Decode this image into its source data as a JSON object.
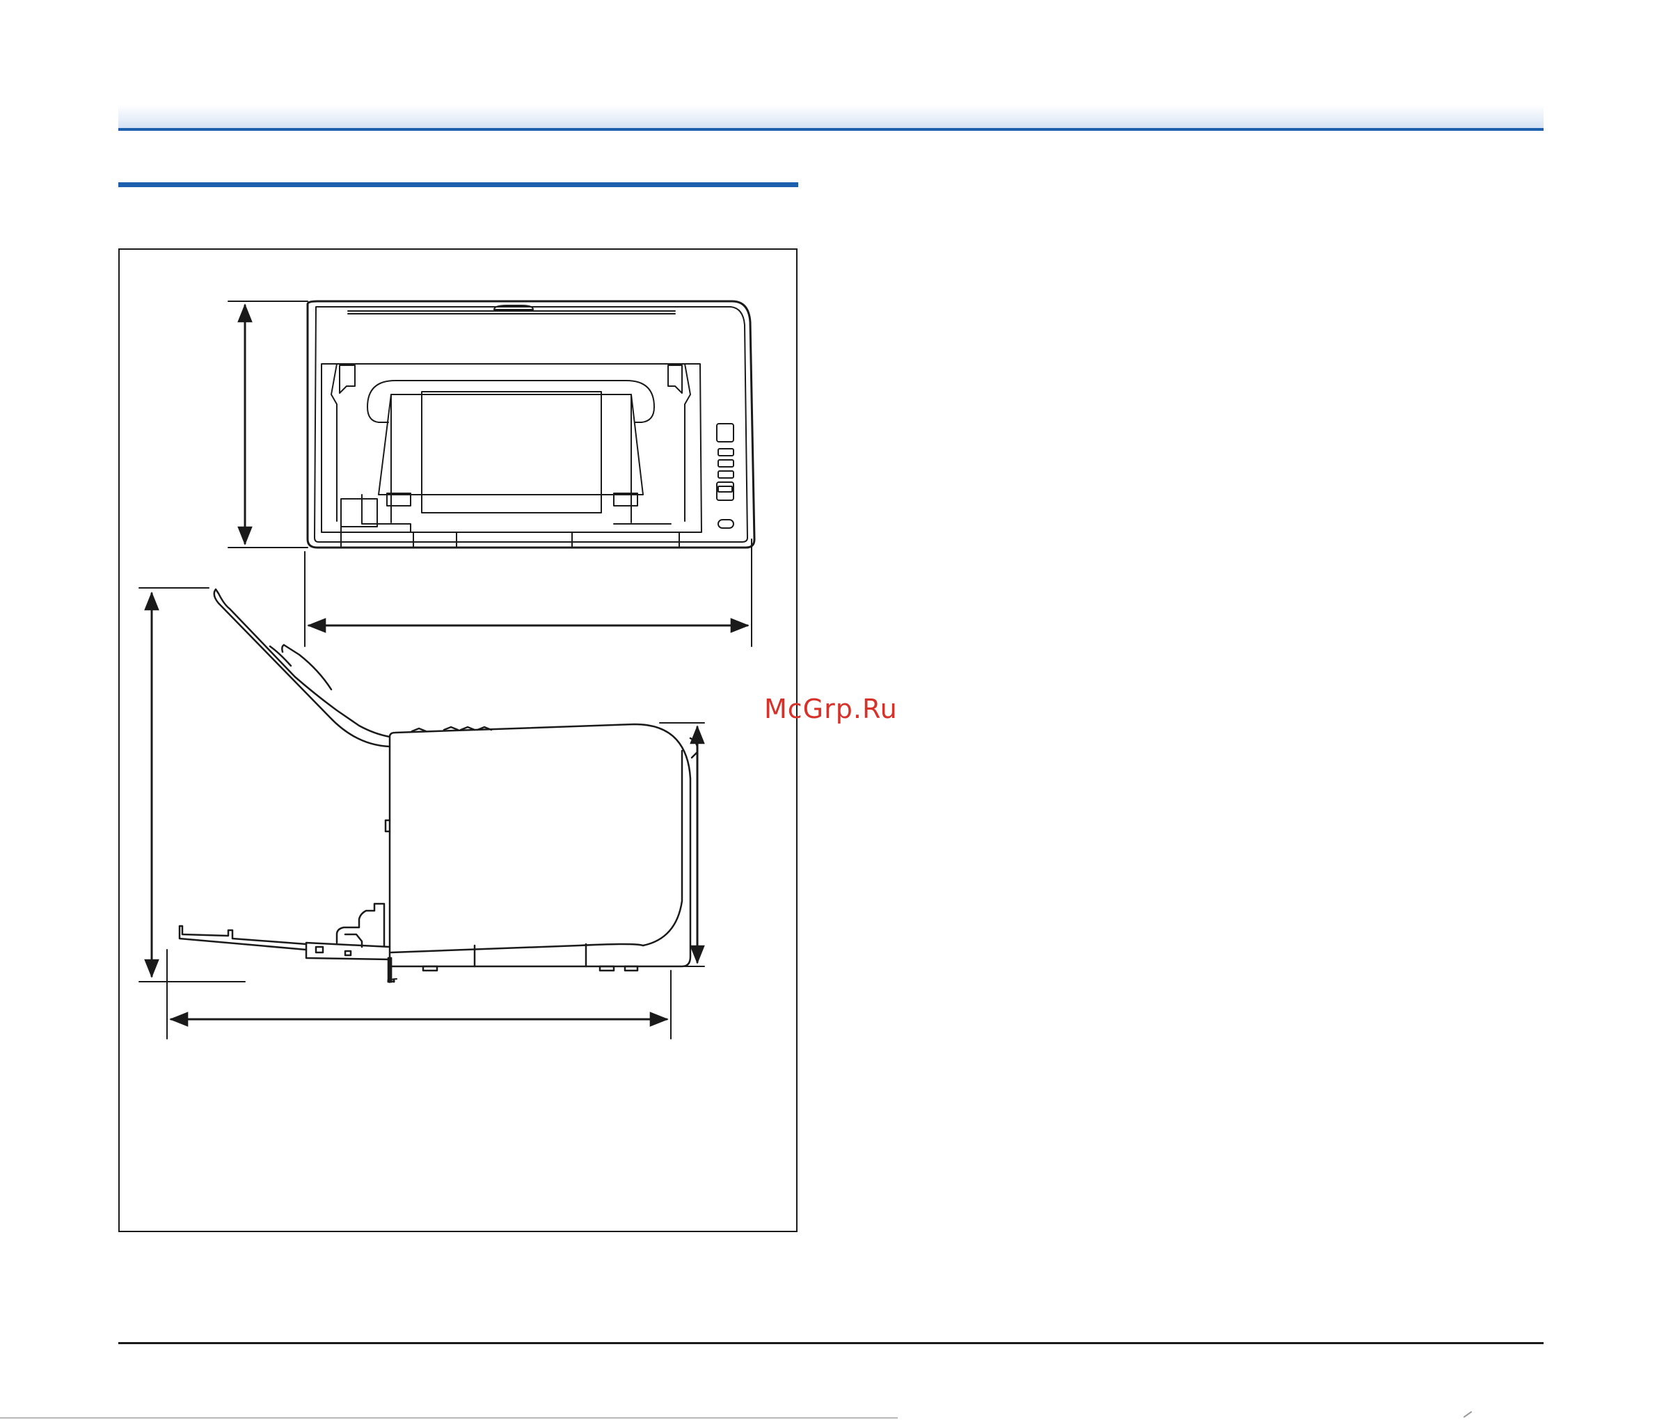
{
  "page": {
    "accent_color": "#1b5fad",
    "line_color": "#1a1a1a"
  },
  "watermark": {
    "text": "McGrp.Ru",
    "color": "#d6322a"
  },
  "figure": {
    "views": [
      "front-view",
      "side-view"
    ],
    "icons": [
      "front-view-scanner-drawing",
      "side-view-scanner-drawing",
      "dimension-arrow"
    ]
  }
}
